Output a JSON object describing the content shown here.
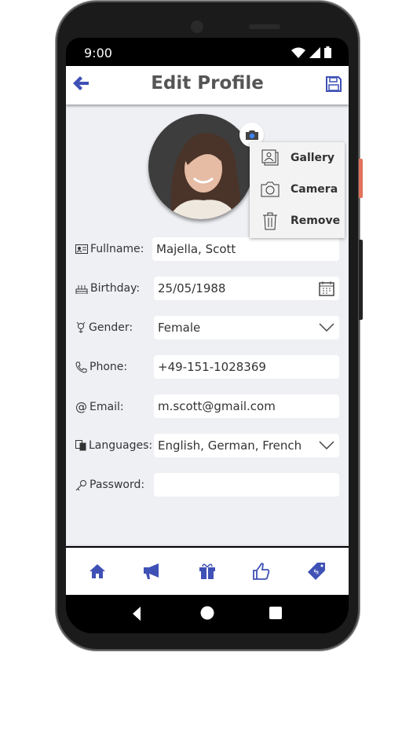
{
  "status": {
    "time": "9:00"
  },
  "header": {
    "title": "Edit Profile",
    "back_icon": "arrow-left-icon",
    "save_icon": "floppy-disk-icon"
  },
  "photo_menu": {
    "items": [
      {
        "label": "Gallery",
        "icon": "gallery-icon"
      },
      {
        "label": "Camera",
        "icon": "camera-icon"
      },
      {
        "label": "Remove",
        "icon": "trash-icon"
      }
    ]
  },
  "form": {
    "fullname": {
      "label": "Fullname:",
      "value": "Majella, Scott"
    },
    "birthday": {
      "label": "Birthday:",
      "value": "25/05/1988"
    },
    "gender": {
      "label": "Gender:",
      "value": "Female"
    },
    "phone": {
      "label": "Phone:",
      "value": "+49-151-1028369"
    },
    "email": {
      "label": "Email:",
      "value": "m.scott@gmail.com"
    },
    "languages": {
      "label": "Languages:",
      "value": "English, German, French"
    },
    "password": {
      "label": "Password:",
      "value": ""
    }
  },
  "bottom_nav": [
    "home-icon",
    "megaphone-icon",
    "gift-icon",
    "thumbs-up-icon",
    "price-tag-icon"
  ],
  "colors": {
    "accent": "#3f51b5",
    "background": "#eff0f4"
  }
}
